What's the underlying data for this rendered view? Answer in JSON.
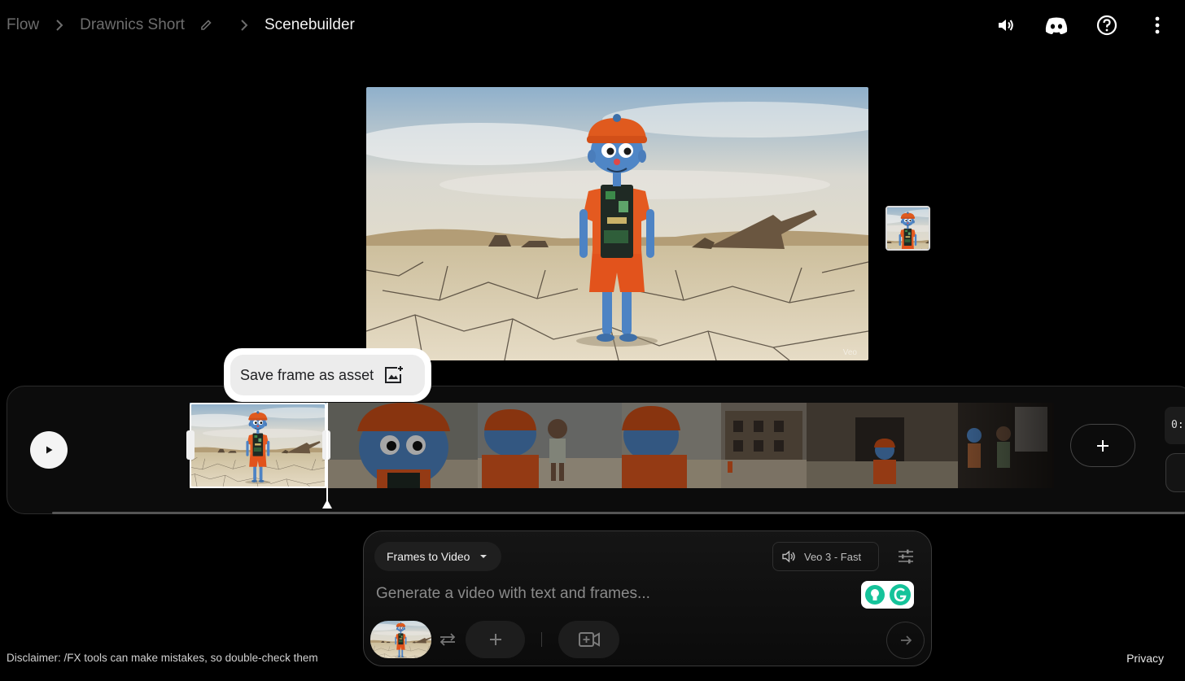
{
  "header": {
    "breadcrumbs": [
      {
        "label": "Flow"
      },
      {
        "label": "Drawnics Short"
      },
      {
        "label": "Scenebuilder"
      }
    ],
    "icons": [
      "volume-icon",
      "discord-icon",
      "help-icon",
      "more-vert-icon"
    ]
  },
  "preview": {
    "watermark": "Veo"
  },
  "tooltip": {
    "label": "Save frame as asset",
    "icon": "add-photo-icon"
  },
  "timeline": {
    "clips": [
      {
        "name": "desert-wide",
        "selected": true
      },
      {
        "name": "closeup-face"
      },
      {
        "name": "two-characters"
      },
      {
        "name": "back-view"
      },
      {
        "name": "ruins-distant"
      },
      {
        "name": "ruins-doorway"
      },
      {
        "name": "dark-interior"
      }
    ],
    "time_readout": "0:"
  },
  "composer": {
    "mode_label": "Frames to Video",
    "model_label": "Veo 3 - Fast",
    "prompt_placeholder": "Generate a video with text and frames..."
  },
  "footer": {
    "disclaimer": "Disclaimer: /FX tools can make mistakes, so double-check them",
    "privacy": "Privacy"
  },
  "colors": {
    "background": "#000000",
    "accent_white": "#ffffff",
    "grammarly_green": "#15c39a"
  }
}
